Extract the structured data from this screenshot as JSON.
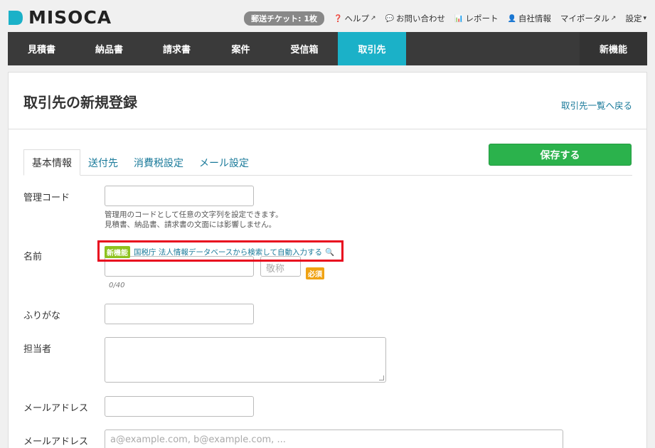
{
  "header": {
    "logo_text": "MISOCA",
    "brand_color": "#1bb1c8",
    "ticket": "郵送チケット: 1枚",
    "help": "ヘルプ",
    "contact": "お問い合わせ",
    "report": "レポート",
    "company": "自社情報",
    "portal": "マイポータル",
    "settings": "設定"
  },
  "nav": {
    "items": [
      {
        "label": "見積書"
      },
      {
        "label": "納品書"
      },
      {
        "label": "請求書"
      },
      {
        "label": "案件"
      },
      {
        "label": "受信箱"
      },
      {
        "label": "取引先"
      }
    ],
    "active_index": 5,
    "new_feature": "新機能"
  },
  "page": {
    "title": "取引先の新規登録",
    "back_link": "取引先一覧へ戻る",
    "save_button": "保存する"
  },
  "tabs": [
    {
      "label": "基本情報",
      "active": true
    },
    {
      "label": "送付先",
      "active": false
    },
    {
      "label": "消費税設定",
      "active": false
    },
    {
      "label": "メール設定",
      "active": false
    }
  ],
  "form": {
    "management_code": {
      "label": "管理コード",
      "help_line1": "管理用のコードとして任意の文字列を設定できます。",
      "help_line2": "見積書、納品書、請求書の文面には影響しません。"
    },
    "name": {
      "label": "名前",
      "new_badge": "新機能",
      "search_link": "国税庁 法人情報データベースから検索して自動入力する",
      "honorific_placeholder": "敬称",
      "required_badge": "必須",
      "counter": "0/40"
    },
    "furigana": {
      "label": "ふりがな"
    },
    "contact_person": {
      "label": "担当者"
    },
    "email": {
      "label": "メールアドレス"
    },
    "email_cc": {
      "label": "メールアドレス",
      "placeholder": "a@example.com, b@example.com, ..."
    }
  }
}
